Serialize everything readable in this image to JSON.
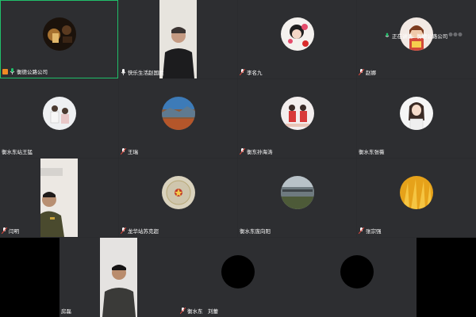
{
  "status": {
    "speaking_prefix": "正在讲话:",
    "speaking_name": "衡德公路公司"
  },
  "participants": [
    {
      "name": "衡德公路公司",
      "muted": false,
      "host": true
    },
    {
      "name": "快乐生活赵国胜",
      "muted": false
    },
    {
      "name": "李名九",
      "muted": true
    },
    {
      "name": "赵娜",
      "muted": true
    },
    {
      "name": "衡水东站王猛",
      "muted": true
    },
    {
      "name": "王瑞",
      "muted": true
    },
    {
      "name": "衡东孙海涛",
      "muted": true
    },
    {
      "name": "衡水东张薇",
      "muted": true
    },
    {
      "name": "闫明",
      "muted": true
    },
    {
      "name": "龙华站苏克超",
      "muted": true
    },
    {
      "name": "衡水东庞向阳",
      "muted": true
    },
    {
      "name": "张宗强",
      "muted": true
    },
    {
      "name": "房磊",
      "muted": true
    },
    {
      "name": "衡水东　刘蕾",
      "muted": true
    },
    {
      "name": "",
      "muted": false
    }
  ],
  "colors": {
    "tile_bg": "#2d2e31",
    "active_border": "#20c06a",
    "host_badge": "#f08a24",
    "mic_on": "#20c06a",
    "mic_off": "#e0453b"
  }
}
